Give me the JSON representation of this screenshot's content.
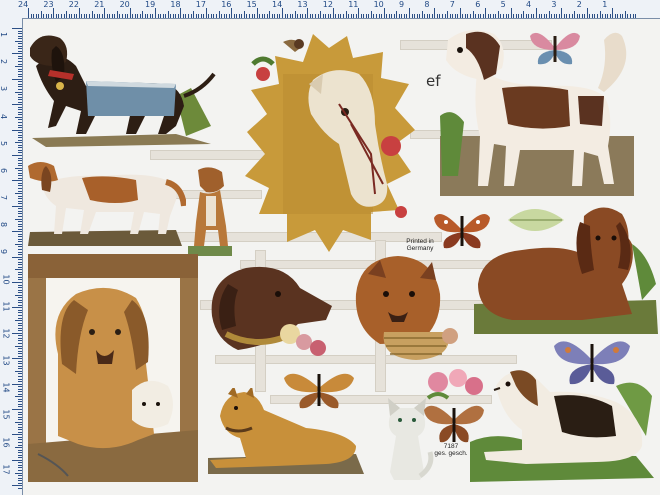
{
  "ruler": {
    "top_numbers": [
      "24",
      "23",
      "22",
      "21",
      "20",
      "19",
      "18",
      "17",
      "16",
      "15",
      "14",
      "13",
      "12",
      "11",
      "10",
      "9",
      "8",
      "7",
      "6",
      "5",
      "4",
      "3",
      "2",
      "1"
    ],
    "left_numbers": [
      "1",
      "2",
      "3",
      "4",
      "5",
      "6",
      "7",
      "8",
      "9",
      "10",
      "11",
      "12",
      "13",
      "14",
      "15",
      "16",
      "17"
    ]
  },
  "sheet": {
    "brand_mark": "ef",
    "printed_in": "Printed in",
    "country": "Germany",
    "sheet_number": "7187",
    "protection": "ges. gesch."
  },
  "colors": {
    "ruler_ink": "#2b4f86",
    "paper": "#f3f3f1",
    "horse_background": "#c89a3a",
    "butterfly_blue": "#7d7fb8",
    "butterfly_orange": "#b85a2a"
  },
  "scraps": [
    "dachshund-scrap",
    "setter-standing-scrap",
    "puppy-sitting-scrap",
    "horse-head-scrap",
    "spaniel-standing-scrap",
    "butterfly-pink-scrap",
    "butterfly-orange-scrap",
    "leaf-scrap",
    "dog-in-kennel-scrap",
    "dog-head-collar-scrap",
    "collie-basket-scrap",
    "red-spaniel-lying-scrap",
    "butterfly-blue-scrap",
    "greyhound-lying-scrap",
    "white-cat-scrap",
    "flowers-butterfly-scrap",
    "spaniel-lying-scrap"
  ]
}
